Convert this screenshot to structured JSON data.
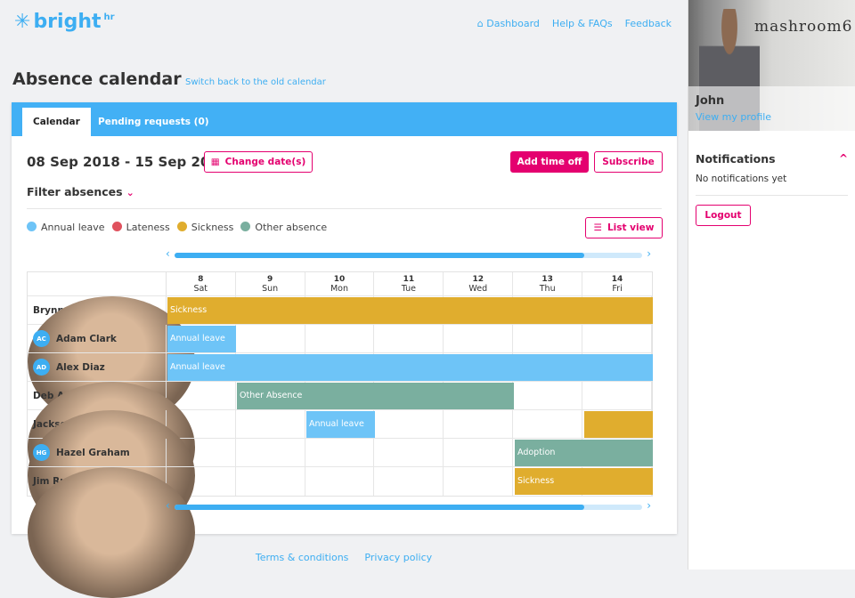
{
  "header": {
    "logo": "bright",
    "logo_sup": "hr",
    "nav": [
      {
        "icon": "home-icon",
        "label": "Dashboard"
      },
      {
        "label": "Help & FAQs"
      },
      {
        "label": "Feedback"
      }
    ]
  },
  "page": {
    "title": "Absence calendar",
    "switch_link": "Switch back to the old calendar"
  },
  "tabs": [
    {
      "label": "Calendar",
      "active": true
    },
    {
      "label": "Pending requests (0)"
    }
  ],
  "toolbar": {
    "date_range": "08 Sep 2018 - 15 Sep 2018",
    "change_dates": "Change date(s)",
    "add_time_off": "Add time off",
    "subscribe": "Subscribe",
    "filter": "Filter absences",
    "list_view": "List view"
  },
  "legend": [
    {
      "label": "Annual leave",
      "color": "#6ec4f7"
    },
    {
      "label": "Lateness",
      "color": "#e0525e"
    },
    {
      "label": "Sickness",
      "color": "#e0ad2e"
    },
    {
      "label": "Other absence",
      "color": "#7aaf9f"
    }
  ],
  "days": [
    {
      "num": "8",
      "name": "Sat"
    },
    {
      "num": "9",
      "name": "Sun"
    },
    {
      "num": "10",
      "name": "Mon"
    },
    {
      "num": "11",
      "name": "Tue"
    },
    {
      "num": "12",
      "name": "Wed"
    },
    {
      "num": "13",
      "name": "Thu"
    },
    {
      "num": "14",
      "name": "Fri"
    }
  ],
  "employees": [
    {
      "name": "Brynne Larson",
      "initials": "",
      "absences": [
        {
          "label": "Sickness",
          "start": 0,
          "end": 7,
          "color": "#e0ad2e"
        }
      ]
    },
    {
      "name": "Adam Clark",
      "initials": "AC",
      "absences": [
        {
          "label": "Annual leave",
          "start": 0,
          "end": 1,
          "color": "#6ec4f7"
        }
      ]
    },
    {
      "name": "Alex Diaz",
      "initials": "AD",
      "absences": [
        {
          "label": "Annual leave",
          "start": 0,
          "end": 7,
          "color": "#6ec4f7"
        }
      ]
    },
    {
      "name": "Deb Ashman",
      "initials": "",
      "absences": [
        {
          "label": "Other Absence",
          "start": 1,
          "end": 5,
          "color": "#7aaf9f"
        }
      ]
    },
    {
      "name": "Jackson Galaxy",
      "initials": "",
      "absences": [
        {
          "label": "Annual leave",
          "start": 2,
          "end": 3,
          "color": "#6ec4f7"
        },
        {
          "label": "",
          "start": 6,
          "end": 7,
          "color": "#e0ad2e"
        }
      ]
    },
    {
      "name": "Hazel Graham",
      "initials": "HG",
      "absences": [
        {
          "label": "Adoption",
          "start": 5,
          "end": 7,
          "color": "#7aaf9f"
        }
      ]
    },
    {
      "name": "Jim Rudolph",
      "initials": "",
      "absences": [
        {
          "label": "Sickness",
          "start": 5,
          "end": 7,
          "color": "#e0ad2e"
        }
      ]
    }
  ],
  "sidebar": {
    "brand_sign": "mashroom6",
    "user": "John",
    "view_profile": "View my profile",
    "notifications_title": "Notifications",
    "notifications_empty": "No notifications yet",
    "logout": "Logout"
  },
  "footer": {
    "terms": "Terms & conditions",
    "privacy": "Privacy policy"
  }
}
